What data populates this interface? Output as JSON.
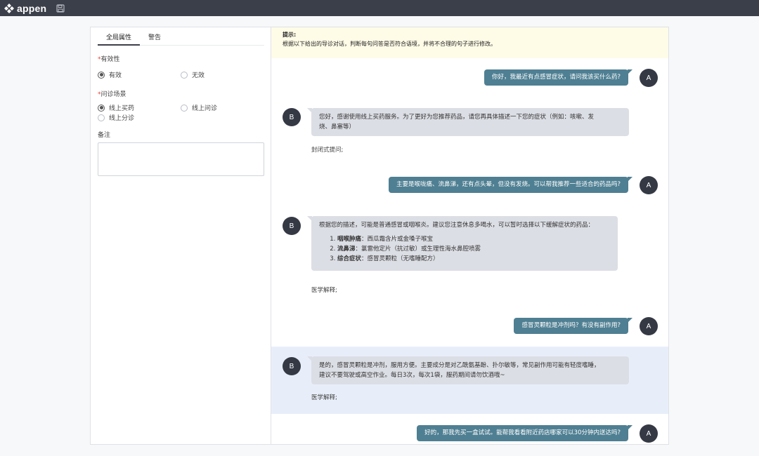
{
  "app": {
    "logo_text": "appen"
  },
  "left_panel": {
    "tabs": [
      "全局属性",
      "警告"
    ],
    "validity": {
      "label": "有效性",
      "options": [
        "有效",
        "无效"
      ],
      "selected": "有效"
    },
    "scenario": {
      "label": "问诊场景",
      "options": [
        "线上买药",
        "线上问诊",
        "线上分诊"
      ],
      "selected": "线上买药"
    },
    "remarks": {
      "label": "备注",
      "value": ""
    }
  },
  "hint": {
    "title": "提示:",
    "text": "根据以下给出的导诊对话，判断每句问答是否符合语境，并将不合理的句子进行修改。"
  },
  "conversation": [
    {
      "speaker": "A",
      "text": "你好，我最近有点感冒症状，请问我该买什么药?"
    },
    {
      "speaker": "B",
      "text_line1": "您好，感谢使用线上买药服务。为了更好为您推荐药品，请您再具体描述一下您的症状（例如：咳嗽、发",
      "text_line2": "烧、鼻塞等）",
      "note": "封闭式提问;"
    },
    {
      "speaker": "A",
      "text": "主要是喉咙痛、流鼻涕，还有点头晕，但没有发烧。可以帮我推荐一些适合的药品吗?"
    },
    {
      "speaker": "B",
      "intro": "根据您的描述，可能是普通感冒或咽喉炎。建议您注意休息多喝水，可以暂时选择以下缓解症状的药品：",
      "items": [
        {
          "bold": "咽喉肿痛",
          "rest": "：西瓜霜含片或金嗓子喉宝"
        },
        {
          "bold": "流鼻涕",
          "rest": "：氯雷他定片（抗过敏）或生理性海水鼻腔喷雾"
        },
        {
          "bold": "综合症状",
          "rest": "：感冒灵颗粒（无嗜睡配方）"
        }
      ],
      "note": "医学解释;"
    },
    {
      "speaker": "A",
      "text": "感冒灵颗粒是冲剂吗？有没有副作用?"
    },
    {
      "speaker": "B",
      "text_line1": "是的，感冒灵颗粒是冲剂，服用方便。主要成分是对乙酰氨基酚、扑尔敏等，常见副作用可能有轻度嗜睡，",
      "text_line2": "建议不要驾驶或高空作业。每日3次，每次1袋，服药期间请勿饮酒哦~",
      "note": "医学解释;"
    },
    {
      "speaker": "A",
      "text": "好的，那我先买一盒试试。能帮我看看附近药店哪家可以30分钟内送达吗?"
    }
  ]
}
